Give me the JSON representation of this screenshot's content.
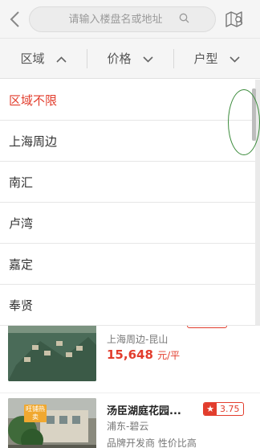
{
  "header": {
    "back_icon": "chevron-left-icon",
    "search_placeholder": "请输入楼盘名或地址",
    "search_icon": "search-icon",
    "map_icon": "map-icon"
  },
  "filters": [
    {
      "label": "区域",
      "icon": "chevron-up-icon",
      "state": "open"
    },
    {
      "label": "价格",
      "icon": "chevron-down-icon",
      "state": "closed"
    },
    {
      "label": "户型",
      "icon": "chevron-down-icon",
      "state": "closed"
    }
  ],
  "dropdown": {
    "options": [
      {
        "label": "区域不限",
        "selected": true
      },
      {
        "label": "上海周边",
        "selected": false
      },
      {
        "label": "南汇",
        "selected": false
      },
      {
        "label": "卢湾",
        "selected": false
      },
      {
        "label": "嘉定",
        "selected": false
      },
      {
        "label": "奉贤",
        "selected": false
      }
    ]
  },
  "listings": [
    {
      "location": "上海周边-昆山",
      "price": "15,648",
      "price_unit": "元/平"
    },
    {
      "title": "汤臣湖庭花园...",
      "rating": "3.75",
      "location": "浦东-碧云",
      "features": "品牌开发商 性价比高",
      "tag": "旺铺热卖"
    }
  ],
  "colors": {
    "accent": "#e23d2d",
    "background": "#f5f5f5"
  }
}
